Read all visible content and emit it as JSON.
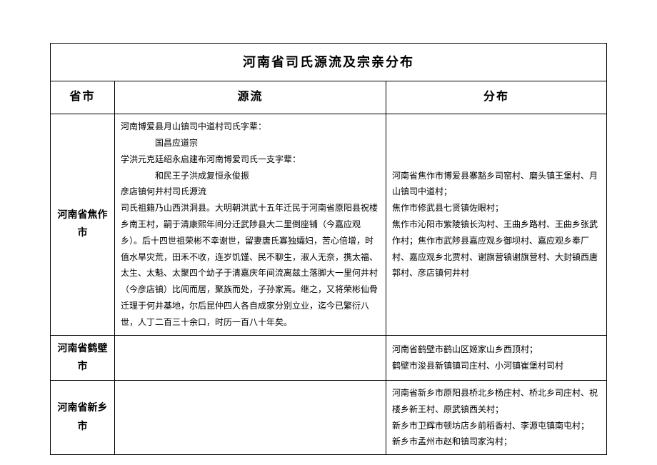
{
  "title": "河南省司氏源流及宗亲分布",
  "headers": {
    "province": "省市",
    "origin": "源流",
    "distribution": "分布"
  },
  "rows": [
    {
      "province": "河南省焦作市",
      "origin_lines": [
        "河南博爱县月山镇司中道村司氏字辈：",
        "　　　　国昌应道宗",
        "学洪元克廷绍永启建布河南博爱司氏一支字辈：",
        "　　　　和民王子洪成复恒永俊振",
        "彦店镇何井村司氏源流",
        "司氏祖籍乃山西洪洞县。大明朝洪武十五年迁民于河南省原阳县祝楼乡南王村，嗣于清康熙年间分迁武陟县大二里倒座铺（今嘉应观乡）。后十四世祖荣彬不幸谢世，留妻唐氏寡独孀妇，苦心倍增，时值水旱灾荒，田禾不收，连岁饥馑、民不聊生，淑人无奈，携太福、太生、太魁、太聚四个幼子于清嘉庆年间流离兹土落脚大一里何井村（今彦店镇）比闾而居，聚族而处，子孙家焉。继之，又将荣彬仙骨迁理于何井基地，尔后昆仲四人各自成家分别立业，迄今已繁衍八世，人丁二百三十余口，时历一百八十年矣。"
      ],
      "distribution_lines": [
        "河南省焦作市博爱县寨豁乡司窑村、磨头镇王堡村、月山镇司中道村；",
        "焦作市修武县七贤镇佐眼村；",
        "焦作市沁阳市紫陵镇长沟村、王曲乡路村、王曲乡张武作村；焦作市武陟县嘉应观乡御坝村、嘉应观乡奉厂村、嘉应观乡北贾村、谢旗营镇谢旗营村、大封镇西唐郭村、彦店镇何井村"
      ]
    },
    {
      "province": "河南省鹤壁市",
      "origin_lines": [],
      "distribution_lines": [
        "河南省鹤壁市鹤山区姬家山乡西顶村；",
        "鹤壁市浚县新镇镇司庄村、小河镇崔堡村司村"
      ]
    },
    {
      "province": "河南省新乡市",
      "origin_lines": [],
      "distribution_lines": [
        "河南省新乡市原阳县桥北乡杨庄村、桥北乡司庄村、祝楼乡新王村、原武镇西关村；",
        "新乡市卫辉市顿坊店乡前稻香村、李源屯镇南屯村；",
        "新乡市孟州市赵和镇司家沟村；"
      ]
    }
  ]
}
